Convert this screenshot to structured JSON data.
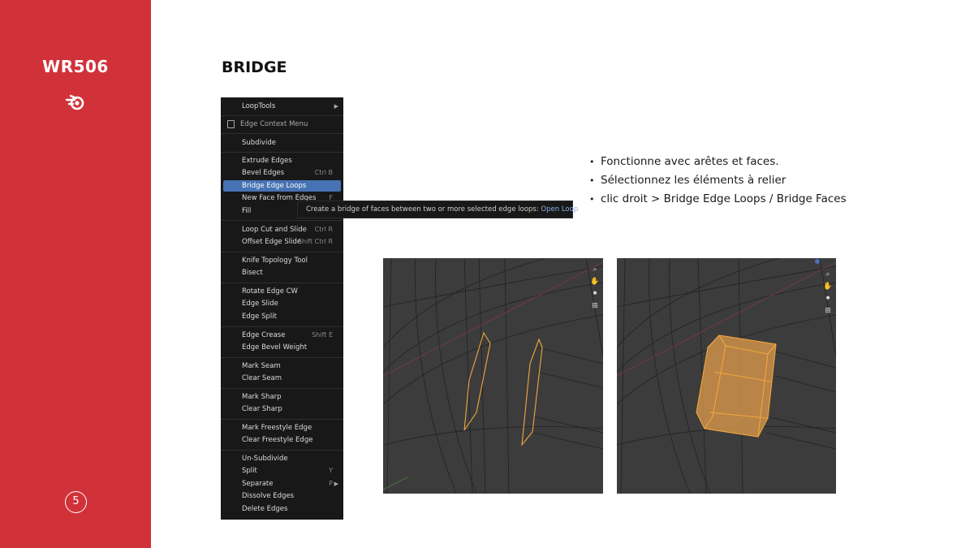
{
  "sidebar": {
    "course_code": "WR506",
    "page_number": "5",
    "logo_icon": "blender-logo-icon",
    "background_color": "#d1323a"
  },
  "slide": {
    "title": "BRIDGE"
  },
  "bullets": [
    "Fonctionne avec arêtes et faces.",
    "Sélectionnez les éléments à relier",
    "clic droit > Bridge Edge Loops / Bridge Faces"
  ],
  "menu": {
    "top_item": "LoopTools",
    "header": "Edge Context Menu",
    "items": [
      {
        "label": "Subdivide",
        "shortcut": ""
      },
      {
        "label": "Extrude Edges",
        "shortcut": ""
      },
      {
        "label": "Bevel Edges",
        "shortcut": "Ctrl B"
      },
      {
        "label": "Bridge Edge Loops",
        "shortcut": ""
      },
      {
        "label": "New Face from Edges",
        "shortcut": "F"
      },
      {
        "label": "Fill",
        "shortcut": ""
      },
      {
        "label": "Loop Cut and Slide",
        "shortcut": "Ctrl R"
      },
      {
        "label": "Offset Edge Slide",
        "shortcut": "Shift Ctrl R"
      },
      {
        "label": "Knife Topology Tool",
        "shortcut": ""
      },
      {
        "label": "Bisect",
        "shortcut": ""
      },
      {
        "label": "Rotate Edge CW",
        "shortcut": ""
      },
      {
        "label": "Edge Slide",
        "shortcut": ""
      },
      {
        "label": "Edge Split",
        "shortcut": ""
      },
      {
        "label": "Edge Crease",
        "shortcut": "Shift E"
      },
      {
        "label": "Edge Bevel Weight",
        "shortcut": ""
      },
      {
        "label": "Mark Seam",
        "shortcut": ""
      },
      {
        "label": "Clear Seam",
        "shortcut": ""
      },
      {
        "label": "Mark Sharp",
        "shortcut": ""
      },
      {
        "label": "Clear Sharp",
        "shortcut": ""
      },
      {
        "label": "Mark Freestyle Edge",
        "shortcut": ""
      },
      {
        "label": "Clear Freestyle Edge",
        "shortcut": ""
      },
      {
        "label": "Un-Subdivide",
        "shortcut": ""
      },
      {
        "label": "Split",
        "shortcut": "Y"
      },
      {
        "label": "Separate",
        "shortcut": "P"
      },
      {
        "label": "Dissolve Edges",
        "shortcut": ""
      },
      {
        "label": "Delete Edges",
        "shortcut": ""
      }
    ],
    "active_item": "Bridge Edge Loops",
    "active_color": "#4772b3"
  },
  "tooltip": {
    "text": "Create a bridge of faces between two or more selected edge loops:",
    "highlight": "Open Loop"
  },
  "viewports": {
    "nav_icons": [
      "zoom-icon",
      "hand-icon",
      "camera-icon",
      "grid-icon"
    ],
    "selection_color": "#f0a640"
  }
}
